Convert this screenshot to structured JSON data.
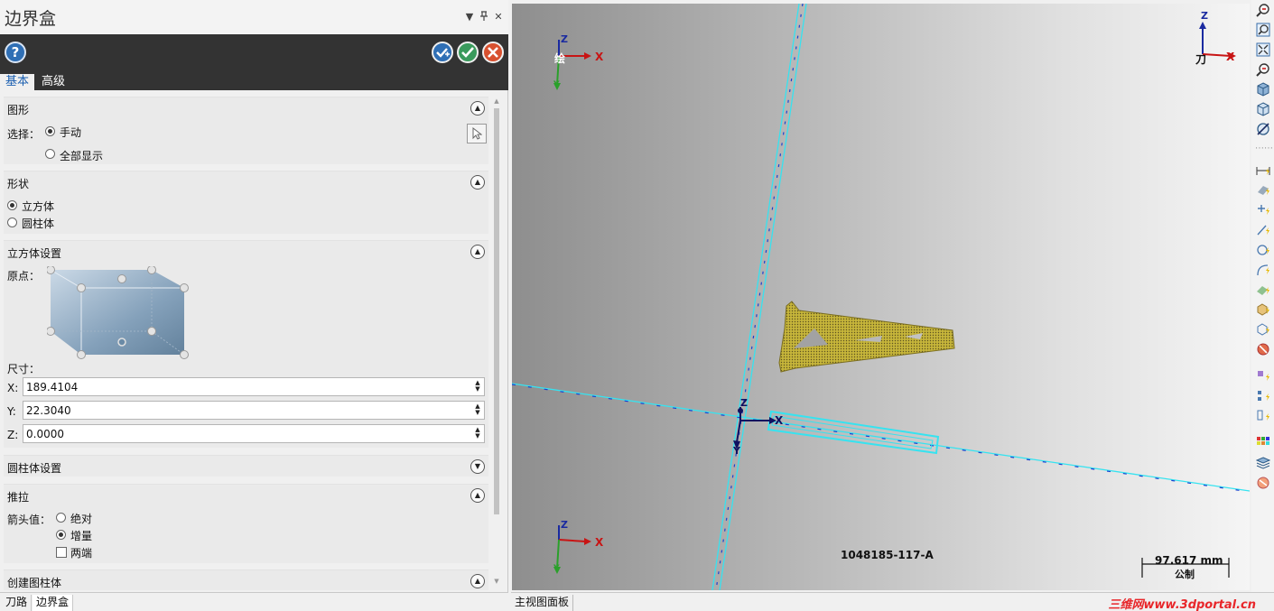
{
  "panel": {
    "title": "边界盒",
    "tabs": [
      "基本",
      "高级"
    ],
    "header_controls": {
      "dropdown": "▼",
      "pin": "ꟷ",
      "close": "✕"
    },
    "help_label": "?",
    "action_buttons": {
      "apply_new": "+",
      "ok": "✓",
      "cancel": "✕"
    }
  },
  "sections": {
    "graphics": {
      "title": "图形",
      "select_label": "选择：",
      "options": [
        "手动",
        "全部显示"
      ],
      "selected": "手动"
    },
    "shape": {
      "title": "形状",
      "options": [
        "立方体",
        "圆柱体"
      ],
      "selected": "立方体"
    },
    "cube_settings": {
      "title": "立方体设置",
      "origin_label": "原点：",
      "size_label": "尺寸：",
      "x_label": "X:",
      "x_value": "189.4104",
      "y_label": "Y:",
      "y_value": "22.3040",
      "z_label": "Z:",
      "z_value": "0.0000"
    },
    "cylinder_settings": {
      "title": "圆柱体设置"
    },
    "push_pull": {
      "title": "推拉",
      "arrow_label": "箭头值：",
      "options": [
        "绝对",
        "增量"
      ],
      "selected": "增量",
      "both_ends_label": "两端",
      "both_ends_checked": false
    },
    "create_cylinder": {
      "title": "创建图柱体"
    }
  },
  "bottom_tabs": [
    "刀路",
    "边界盒"
  ],
  "viewport": {
    "axis_top_left": {
      "z": "Z",
      "x": "X",
      "y": "Y",
      "label": "绘"
    },
    "axis_top_right": {
      "z": "Z",
      "x": "X",
      "label": "刀"
    },
    "axis_center": {
      "z": "Z",
      "x": "X",
      "y": "Y"
    },
    "axis_bottom_left": {
      "z": "Z",
      "x": "X",
      "y": "Y"
    },
    "part_number": "1048185-117-A",
    "scale_value": "97.617 mm",
    "scale_unit": "公制"
  },
  "status_bar": {
    "tab": "主视图面板",
    "watermark": "三维网www.3dportal.cn"
  },
  "colors": {
    "dark_bar": "#333333",
    "accent_blue": "#1b5fb0",
    "ok_green": "#3a9a5c",
    "cancel_red": "#d8512f",
    "boundary_cyan": "#36e3f0",
    "part_yellow": "#c6b53a"
  }
}
